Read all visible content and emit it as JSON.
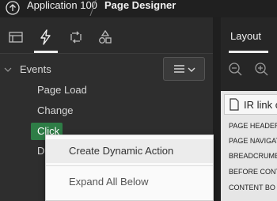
{
  "header": {
    "app_title": "Application 100",
    "page_title": "Page Designer"
  },
  "left_panel": {
    "tabs": [
      {
        "name": "rendering-icon"
      },
      {
        "name": "dynamic-actions-icon"
      },
      {
        "name": "processing-icon"
      },
      {
        "name": "shared-components-icon"
      }
    ],
    "tree": {
      "events_label": "Events",
      "items": [
        "Page Load",
        "Change",
        "Click",
        "Di"
      ]
    }
  },
  "right_panel": {
    "tab_label": "Layout",
    "region_title": "IR link c",
    "slots": [
      "PAGE HEADER",
      "PAGE NAVIGATI",
      "BREADCRUMB",
      "BEFORE CONT",
      "CONTENT BO"
    ]
  },
  "context_menu": {
    "items": [
      "Create Dynamic Action",
      "Expand All Below"
    ]
  },
  "colors": {
    "selected": "#2e7d46",
    "dark_bg": "#2e2e2e",
    "menu_bg": "#fafafa"
  }
}
